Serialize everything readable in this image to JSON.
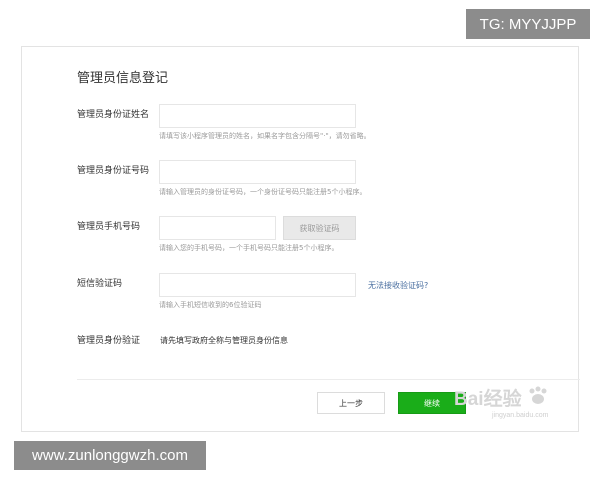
{
  "overlays": {
    "top_tag": "TG: MYYJJPP",
    "bottom_tag": "www.zunlonggwzh.com"
  },
  "form": {
    "title": "管理员信息登记",
    "name": {
      "label": "管理员身份证姓名",
      "value": "",
      "hint": "请填写该小程序管理员的姓名，如果名字包含分隔号\"·\"，请勿省略。"
    },
    "id_number": {
      "label": "管理员身份证号码",
      "value": "",
      "hint": "请输入管理员的身份证号码，一个身份证号码只能注册5个小程序。"
    },
    "phone": {
      "label": "管理员手机号码",
      "value": "",
      "hint": "请输入您的手机号码，一个手机号码只能注册5个小程序。",
      "code_button": "获取验证码"
    },
    "sms_code": {
      "label": "短信验证码",
      "value": "",
      "hint": "请输入手机短信收到的6位验证码",
      "link": "无法接收验证码?"
    },
    "verify": {
      "label": "管理员身份验证",
      "text": "请先填写政府全称与管理员身份信息"
    }
  },
  "footer": {
    "prev_label": "上一步",
    "next_label": "继续"
  },
  "watermark": {
    "text": "Bai经验",
    "url": "jingyan.baidu.com"
  }
}
